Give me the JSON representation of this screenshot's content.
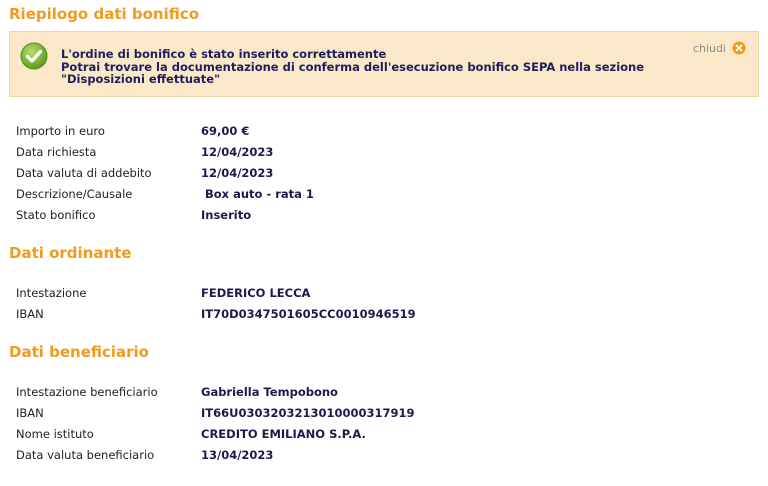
{
  "summary": {
    "title": "Riepilogo dati bonifico",
    "notice": {
      "line1": "L'ordine di bonifico è stato inserito correttamente",
      "line2": "Potrai trovare la documentazione di conferma dell'esecuzione bonifico SEPA nella sezione",
      "line3": "\"Disposizioni effettuate\"",
      "close_label": "chiudi",
      "icon": "check-circle-icon",
      "close_icon": "close-circle-icon"
    },
    "rows": [
      {
        "label": "Importo in euro",
        "value": "69,00 €"
      },
      {
        "label": "Data richiesta",
        "value": "12/04/2023"
      },
      {
        "label": "Data valuta di addebito",
        "value": "12/04/2023"
      },
      {
        "label": "Descrizione/Causale",
        "value": " Box auto - rata 1"
      },
      {
        "label": "Stato bonifico",
        "value": "Inserito"
      }
    ]
  },
  "ordinante": {
    "title": "Dati ordinante",
    "rows": [
      {
        "label": "Intestazione",
        "value": "FEDERICO LECCA"
      },
      {
        "label": "IBAN",
        "value": "IT70D0347501605CC0010946519"
      }
    ]
  },
  "beneficiario": {
    "title": "Dati beneficiario",
    "rows": [
      {
        "label": "Intestazione beneficiario",
        "value": "Gabriella Tempobono"
      },
      {
        "label": "IBAN",
        "value": "IT66U0303203213010000317919"
      },
      {
        "label": "Nome istituto",
        "value": "CREDITO EMILIANO S.P.A."
      },
      {
        "label": "Data valuta beneficiario",
        "value": "13/04/2023"
      }
    ]
  },
  "colors": {
    "section_title": "#f29a1f",
    "notice_background": "#fbe8c8",
    "value_text": "#1a1a4e",
    "success_icon": "#7dbb2f",
    "close_icon": "#f29a1f"
  }
}
